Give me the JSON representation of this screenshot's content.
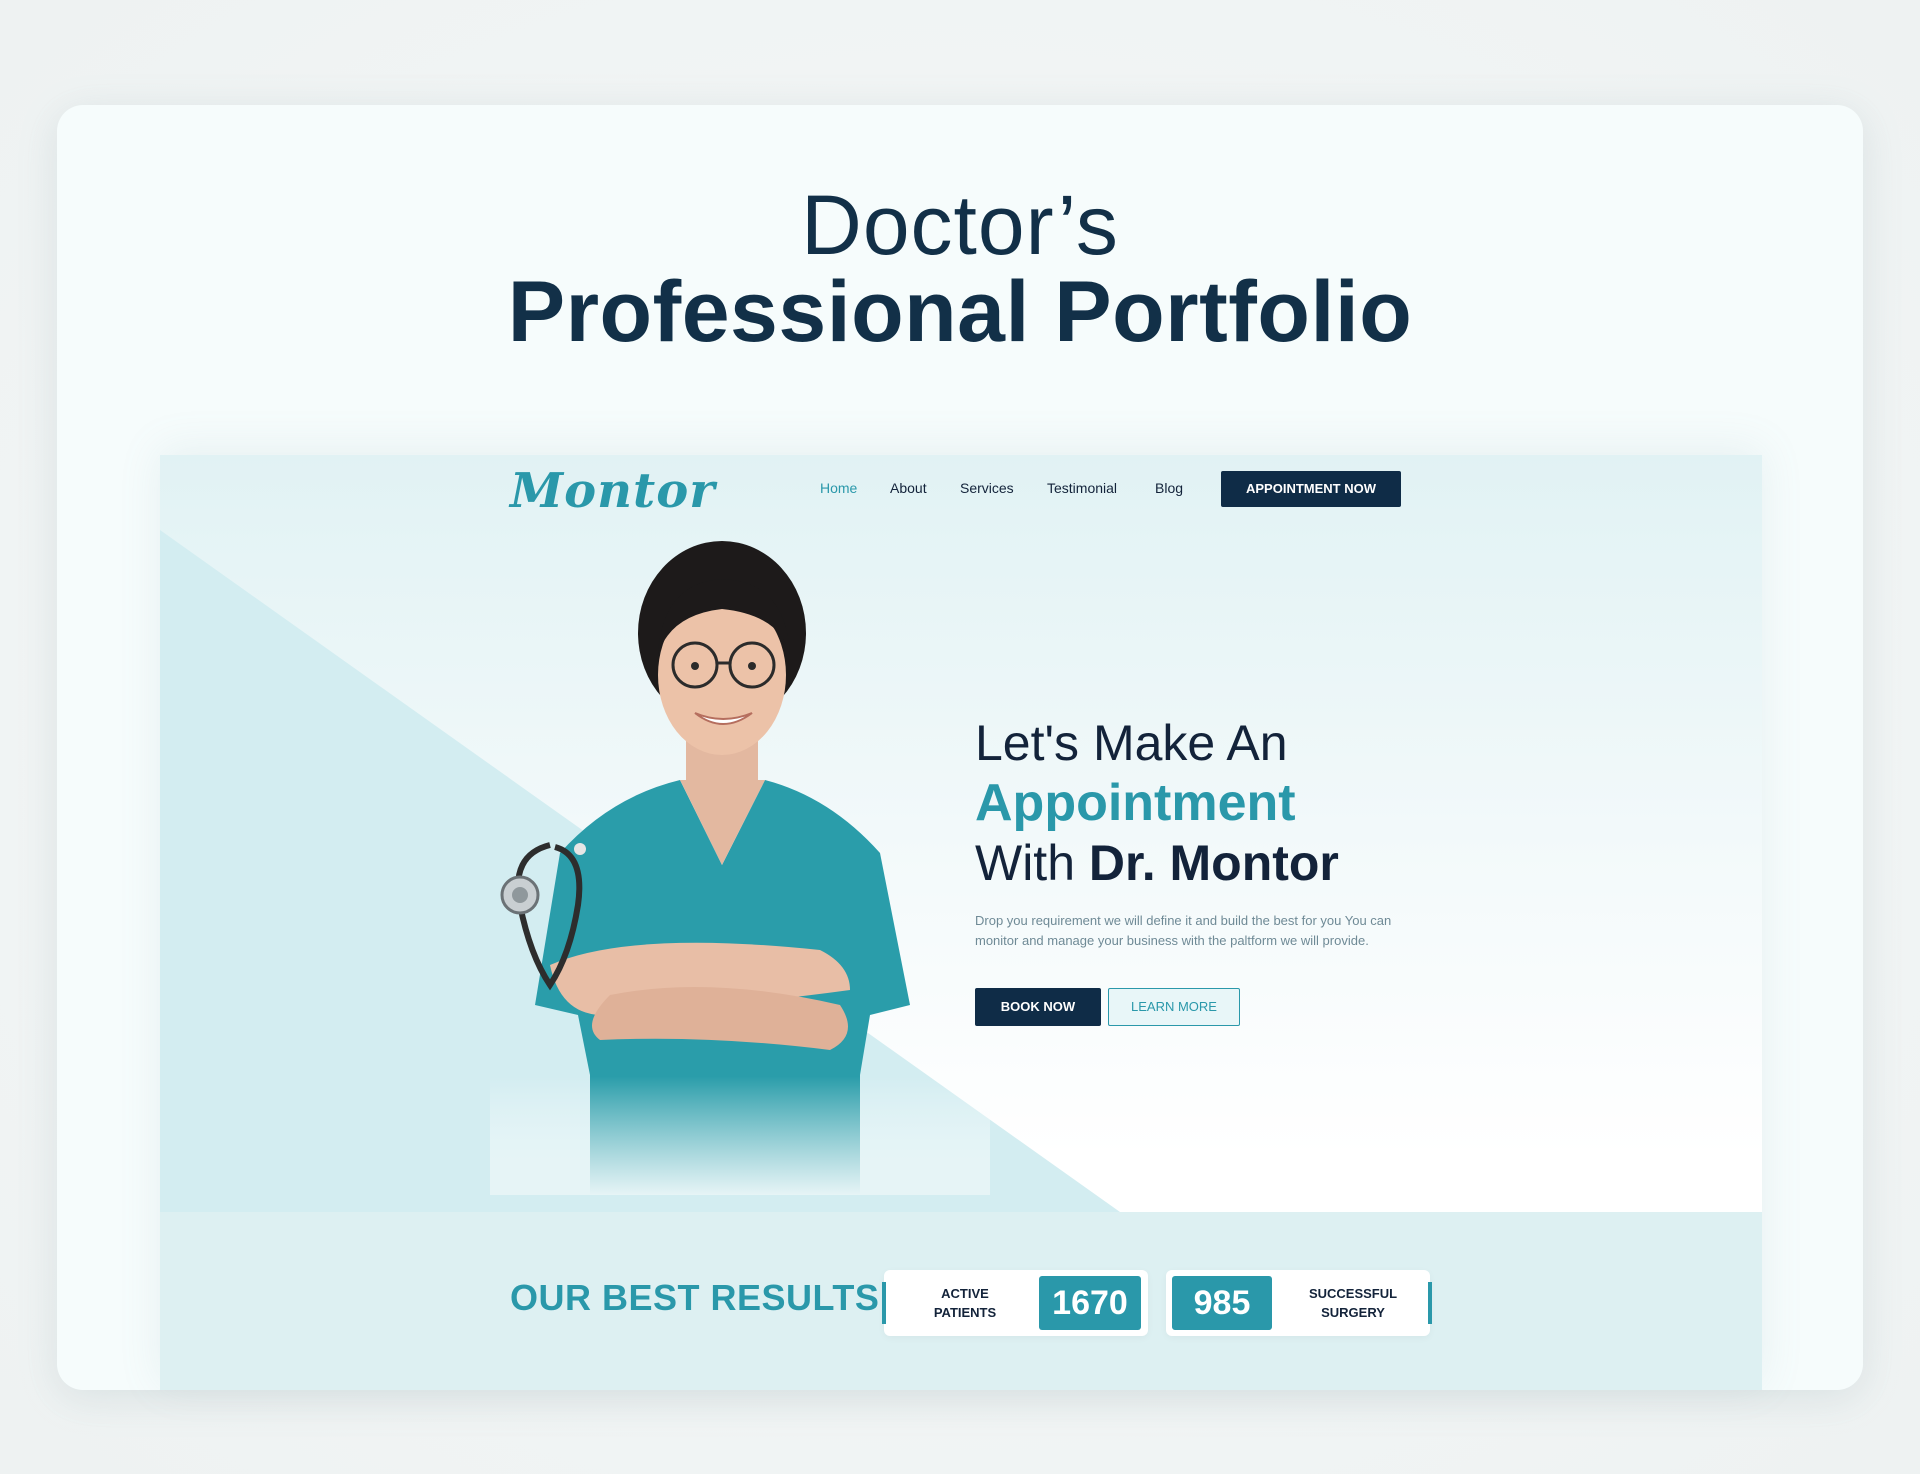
{
  "showcase": {
    "title_line1": "Doctor’s",
    "title_line2": "Professional Portfolio"
  },
  "site": {
    "logo": "Montor",
    "nav": {
      "items": [
        {
          "label": "Home",
          "active": true
        },
        {
          "label": "About",
          "active": false
        },
        {
          "label": "Services",
          "active": false
        },
        {
          "label": "Testimonial",
          "active": false
        },
        {
          "label": "Blog",
          "active": false
        }
      ],
      "cta_label": "APPOINTMENT NOW"
    },
    "hero": {
      "line1": "Let's Make An",
      "line2": "Appointment",
      "line3_prefix": "With ",
      "line3_name": "Dr. Montor",
      "description": "Drop you requirement we will define it and build the best for you You can monitor and manage your business with the paltform we will provide.",
      "book_label": "BOOK NOW",
      "learn_label": "LEARN MORE"
    },
    "results": {
      "title": "OUR BEST RESULTS",
      "stats": [
        {
          "label": "ACTIVE PATIENTS",
          "value": "1670"
        },
        {
          "label": "SUCCESSFUL SURGERY",
          "value": "985"
        }
      ]
    }
  },
  "colors": {
    "accent": "#2a98aa",
    "navy": "#0f2c47",
    "text": "#13233a",
    "card_bg": "#f6fcfc",
    "band_bg": "#ddf0f2"
  },
  "icons": [
    "stethoscope-icon"
  ]
}
